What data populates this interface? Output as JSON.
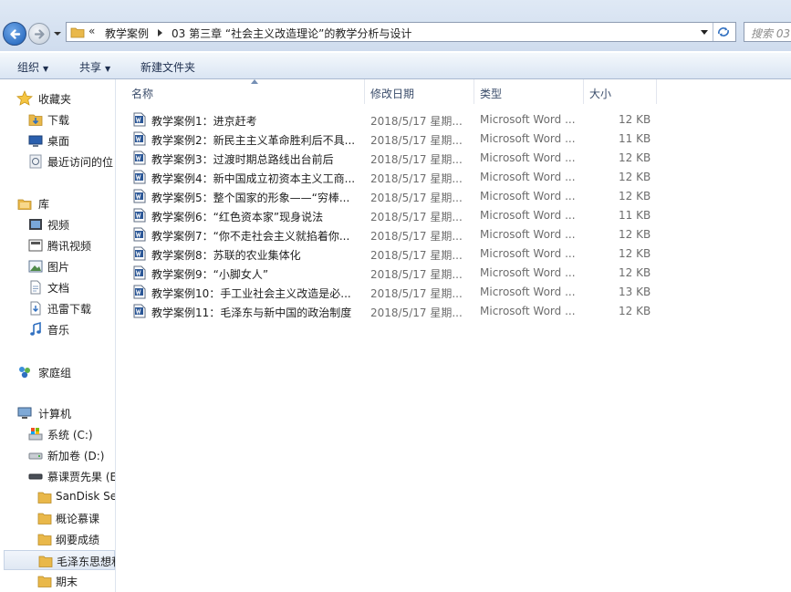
{
  "address": {
    "overflow_glyph": "«",
    "crumbs": [
      "教学案例",
      "03 第三章 “社会主义改造理论”的教学分析与设计"
    ]
  },
  "search": {
    "placeholder": "搜索 03"
  },
  "toolbar": {
    "organize": "组织",
    "share": "共享",
    "new_folder": "新建文件夹"
  },
  "sidebar": {
    "favorites": {
      "label": "收藏夹",
      "items": [
        "下载",
        "桌面",
        "最近访问的位"
      ]
    },
    "libraries": {
      "label": "库",
      "items": [
        "视频",
        "腾讯视频",
        "图片",
        "文档",
        "迅雷下载",
        "音乐"
      ]
    },
    "homegroup": {
      "label": "家庭组"
    },
    "computer": {
      "label": "计算机",
      "drives": [
        "系统 (C:)",
        "新加卷 (D:)",
        "慕课贾先果 (E"
      ],
      "folders": [
        "SanDisk Se",
        "概论慕课",
        "纲要成绩",
        "毛泽东思想和",
        "期末"
      ],
      "selected_folder_index": 3
    }
  },
  "columns": {
    "name": "名称",
    "date": "修改日期",
    "type": "类型",
    "size": "大小"
  },
  "files": [
    {
      "name": "教学案例1：进京赶考",
      "date": "2018/5/17 星期...",
      "type": "Microsoft Word ...",
      "size": "12 KB"
    },
    {
      "name": "教学案例2：新民主主义革命胜利后不具...",
      "date": "2018/5/17 星期...",
      "type": "Microsoft Word ...",
      "size": "11 KB"
    },
    {
      "name": "教学案例3：过渡时期总路线出台前后",
      "date": "2018/5/17 星期...",
      "type": "Microsoft Word ...",
      "size": "12 KB"
    },
    {
      "name": "教学案例4：新中国成立初资本主义工商...",
      "date": "2018/5/17 星期...",
      "type": "Microsoft Word ...",
      "size": "12 KB"
    },
    {
      "name": "教学案例5：整个国家的形象——“穷棒...",
      "date": "2018/5/17 星期...",
      "type": "Microsoft Word ...",
      "size": "12 KB"
    },
    {
      "name": "教学案例6：“红色资本家”现身说法",
      "date": "2018/5/17 星期...",
      "type": "Microsoft Word ...",
      "size": "11 KB"
    },
    {
      "name": "教学案例7：“你不走社会主义就掐着你...",
      "date": "2018/5/17 星期...",
      "type": "Microsoft Word ...",
      "size": "12 KB"
    },
    {
      "name": "教学案例8：苏联的农业集体化",
      "date": "2018/5/17 星期...",
      "type": "Microsoft Word ...",
      "size": "12 KB"
    },
    {
      "name": "教学案例9：“小脚女人”",
      "date": "2018/5/17 星期...",
      "type": "Microsoft Word ...",
      "size": "12 KB"
    },
    {
      "name": "教学案例10：手工业社会主义改造是必...",
      "date": "2018/5/17 星期...",
      "type": "Microsoft Word ...",
      "size": "13 KB"
    },
    {
      "name": "教学案例11：毛泽东与新中国的政治制度",
      "date": "2018/5/17 星期...",
      "type": "Microsoft Word ...",
      "size": "12 KB"
    }
  ],
  "icons": {
    "back": "back-arrow-icon",
    "forward": "forward-arrow-icon",
    "refresh": "refresh-icon",
    "folder": "folder-icon",
    "word_doc": "word-document-icon",
    "favorites": "star-icon",
    "library": "library-icon",
    "homegroup": "homegroup-icon",
    "computer": "computer-icon",
    "drive": "drive-icon"
  },
  "colors": {
    "folder": "#e9b84a",
    "selection": "#e0e8f3",
    "word_blue": "#2b5797",
    "back_button": "#1b5fb8"
  }
}
